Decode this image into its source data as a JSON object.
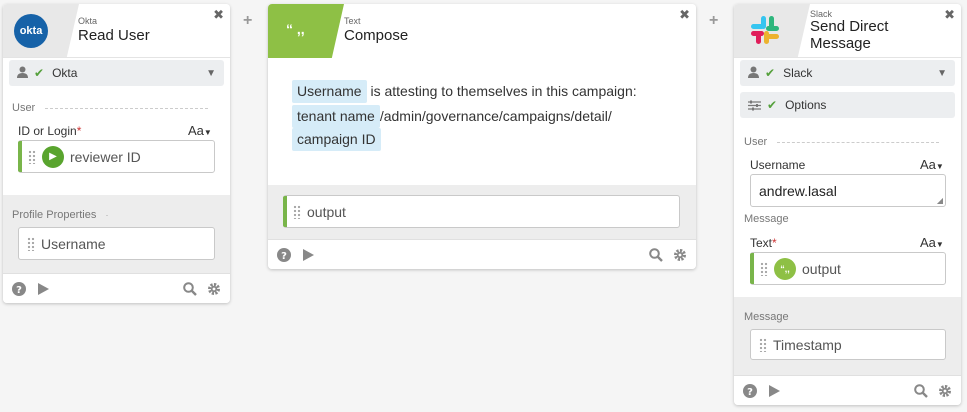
{
  "colors": {
    "okta_blue": "#1662a8",
    "text_green": "#8ec045",
    "check_green": "#55a03c",
    "chip_blue": "#d6ecf8",
    "left_bar_green": "#79b54a"
  },
  "card1": {
    "app_name": "Okta",
    "title": "Read User",
    "logo_text": "okta",
    "connection": "Okta",
    "section_user": "User",
    "field_label": "ID or Login",
    "required_mark": "*",
    "aa": "Aa",
    "input_value": "reviewer ID",
    "section_profile": "Profile Properties",
    "profile_field": "Username",
    "close": "✖"
  },
  "card2": {
    "app_name": "Text",
    "title": "Compose",
    "quote_glyph": "“ ,,",
    "chip_username": "Username",
    "text_1": "is attesting to themselves in this campaign:",
    "chip_tenant": "tenant name",
    "text_2": "/admin/governance/campaigns/detail/",
    "chip_campaign": "campaign ID",
    "output": "output",
    "close": "✖"
  },
  "card3": {
    "app_name": "Slack",
    "title_line1": "Send Direct",
    "title_line2": "Message",
    "connection": "Slack",
    "options": "Options",
    "section_user": "User",
    "username_label": "Username",
    "aa": "Aa",
    "username_value": "andrew.lasal",
    "section_message": "Message",
    "text_label": "Text",
    "required_mark": "*",
    "text_value": "output",
    "section_message2": "Message",
    "timestamp": "Timestamp",
    "close": "✖"
  },
  "plus": "+"
}
